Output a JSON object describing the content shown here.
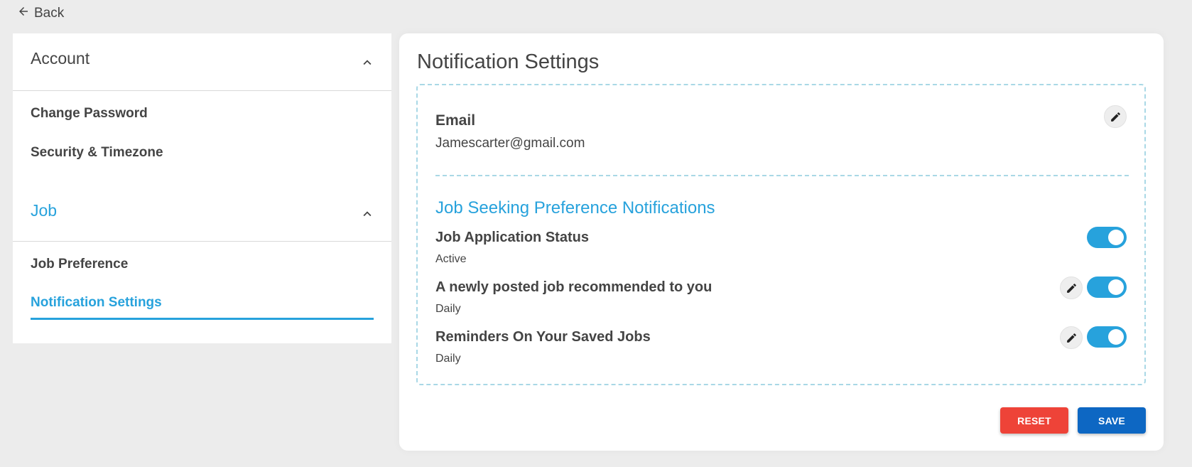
{
  "nav": {
    "back_label": "Back",
    "back_icon": "arrow-left-icon"
  },
  "sidebar": {
    "sections": [
      {
        "title": "Account",
        "expanded": true,
        "active": false,
        "items": [
          {
            "label": "Change Password",
            "active": false
          },
          {
            "label": "Security & Timezone",
            "active": false
          }
        ]
      },
      {
        "title": "Job",
        "expanded": true,
        "active": true,
        "items": [
          {
            "label": "Job Preference",
            "active": false
          },
          {
            "label": "Notification Settings",
            "active": true
          }
        ]
      }
    ]
  },
  "main": {
    "title": "Notification Settings",
    "email": {
      "label": "Email",
      "value": "Jamescarter@gmail.com",
      "edit_icon": "pencil-icon"
    },
    "job_notifications": {
      "heading": "Job Seeking Preference Notifications",
      "items": [
        {
          "title": "Job Application Status",
          "frequency": "Active",
          "enabled": true,
          "editable": false
        },
        {
          "title": "A newly posted job recommended to you",
          "frequency": "Daily",
          "enabled": true,
          "editable": true
        },
        {
          "title": "Reminders On Your Saved Jobs",
          "frequency": "Daily",
          "enabled": true,
          "editable": true
        }
      ]
    },
    "actions": {
      "reset_label": "RESET",
      "save_label": "SAVE"
    }
  },
  "colors": {
    "accent": "#27a2dc",
    "reset": "#ee4338",
    "save": "#0d67c3",
    "dashed_border": "#a9d8e6",
    "background": "#ececec"
  }
}
